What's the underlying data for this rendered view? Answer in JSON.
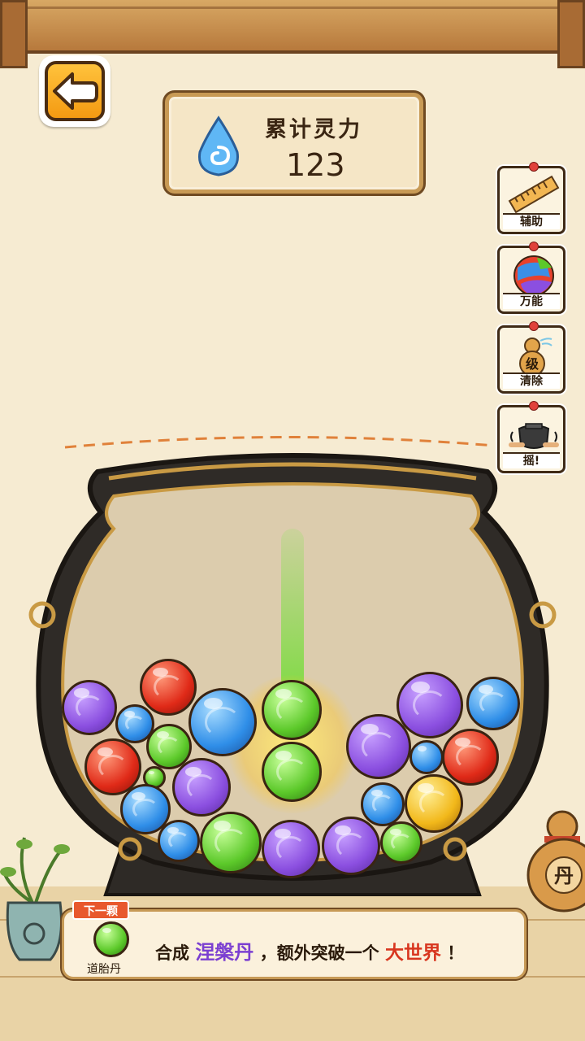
{
  "hud": {
    "back_icon": "back-arrow-icon",
    "score_title": "累计灵力",
    "score_value": "123",
    "score_icon": "spirit-drop-icon"
  },
  "tools": [
    {
      "label": "辅助",
      "icon": "ruler-icon"
    },
    {
      "label": "万能",
      "icon": "rainbow-orb-icon"
    },
    {
      "label": "清除",
      "icon": "gourd-icon"
    },
    {
      "label": "摇!",
      "icon": "shake-cauldron-icon"
    }
  ],
  "next": {
    "tag": "下一颗",
    "name": "道胎丹",
    "color": "#5cc92a"
  },
  "tip": {
    "prefix": "合成",
    "highlight1": "涅槃丹",
    "middle": "，额外突破一个",
    "highlight2": "大世界",
    "suffix": "！"
  },
  "colors": {
    "purple": "#8b4fe0",
    "blue": "#2f8ee8",
    "red": "#e02a18",
    "green": "#5cc92a",
    "yellow": "#f2b81a",
    "accent": "#e8582d"
  }
}
